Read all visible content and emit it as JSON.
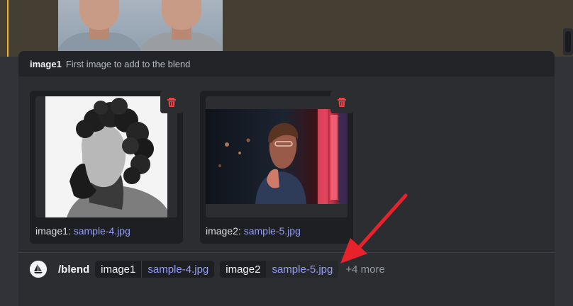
{
  "popup": {
    "option_name": "image1",
    "option_description": "First image to add to the blend"
  },
  "attachments": [
    {
      "prefix": "image1: ",
      "filename": "sample-4.jpg"
    },
    {
      "prefix": "image2: ",
      "filename": "sample-5.jpg"
    }
  ],
  "command": {
    "name": "/blend",
    "params": [
      {
        "key": "image1",
        "value": "sample-4.jpg"
      },
      {
        "key": "image2",
        "value": "sample-5.jpg"
      }
    ],
    "more": "+4 more"
  },
  "icons": {
    "trash": "trash-icon",
    "bot_avatar": "midjourney-avatar-icon",
    "annotation": "red-arrow-icon"
  },
  "colors": {
    "accent_link": "#949cf7",
    "danger": "#f23f42",
    "annotation_arrow": "#e8222b"
  }
}
